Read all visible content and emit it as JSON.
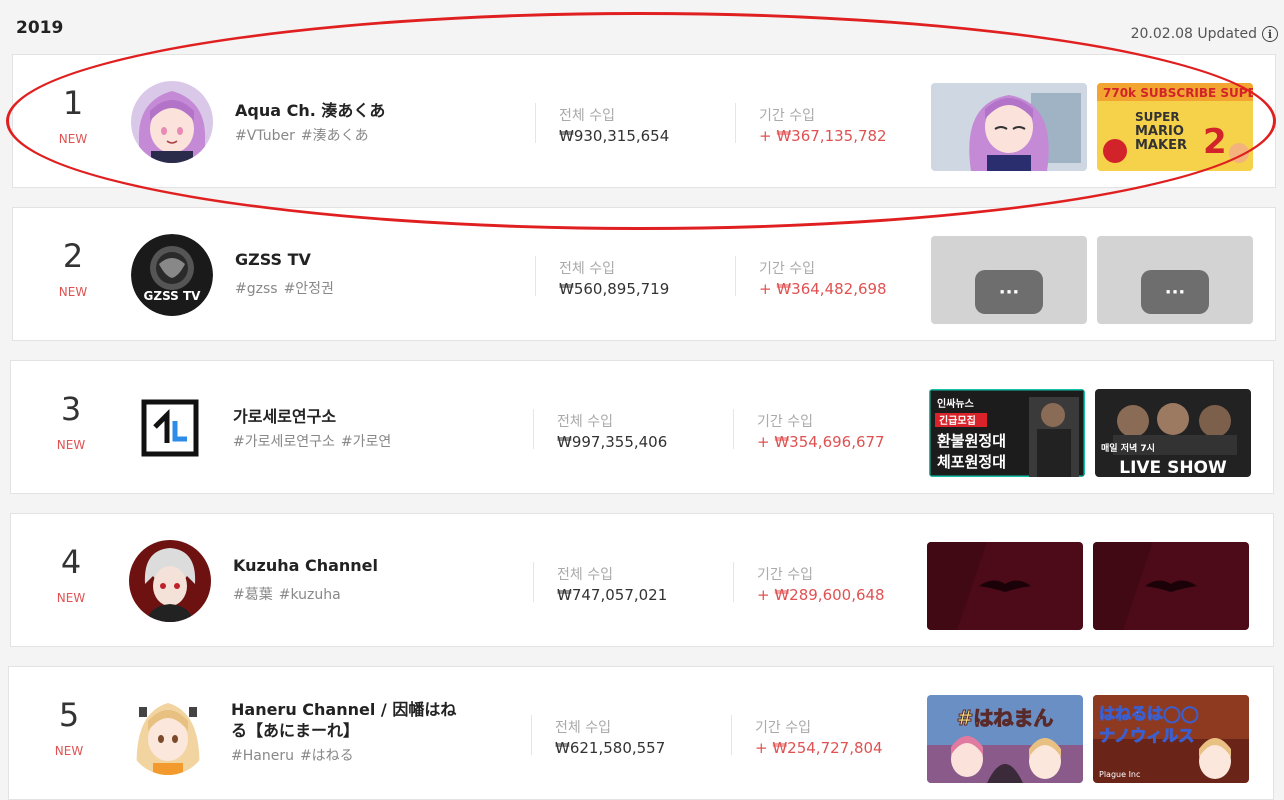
{
  "header": {
    "year": "2019",
    "updated": "20.02.08 Updated"
  },
  "labels": {
    "total": "전체 수입",
    "period": "기간 수입"
  },
  "colors": {
    "accent_red": "#e05252",
    "annotation_red": "#e02020"
  },
  "rows": [
    {
      "rank": "1",
      "badge": "NEW",
      "name": "Aqua Ch. 湊あくあ",
      "tags": [
        "#VTuber",
        "#湊あくあ"
      ],
      "total": "₩930,315,654",
      "period": "+ ₩367,135,782",
      "thumbs": [
        {
          "overlay": ""
        },
        {
          "overlay": "770k SUBSCRIBE SUPER MARIO MAKER 2"
        }
      ]
    },
    {
      "rank": "2",
      "badge": "NEW",
      "name": "GZSS TV",
      "tags": [
        "#gzss",
        "#안정권"
      ],
      "total": "₩560,895,719",
      "period": "+ ₩364,482,698",
      "thumbs": [
        {
          "overlay": "···"
        },
        {
          "overlay": "···"
        }
      ]
    },
    {
      "rank": "3",
      "badge": "NEW",
      "name": "가로세로연구소",
      "tags": [
        "#가로세로연구소",
        "#가로연"
      ],
      "total": "₩997,355,406",
      "period": "+ ₩354,696,677",
      "thumbs": [
        {
          "overlay": "인싸뉴스 긴급모집 환불원정대 체포원정대"
        },
        {
          "overlay": "매일 저녁 7시 LIVE SHOW"
        }
      ]
    },
    {
      "rank": "4",
      "badge": "NEW",
      "name": "Kuzuha Channel",
      "tags": [
        "#葛葉",
        "#kuzuha"
      ],
      "total": "₩747,057,021",
      "period": "+ ₩289,600,648",
      "thumbs": [
        {
          "overlay": ""
        },
        {
          "overlay": ""
        }
      ]
    },
    {
      "rank": "5",
      "badge": "NEW",
      "name": "Haneru Channel / 因幡はねる【あにまーれ】",
      "tags": [
        "#Haneru",
        "#はねる"
      ],
      "total": "₩621,580,557",
      "period": "+ ₩254,727,804",
      "thumbs": [
        {
          "overlay": "#はねまん"
        },
        {
          "overlay": "はねるは◯◯ ナノウィルス Plague Inc"
        }
      ]
    }
  ]
}
